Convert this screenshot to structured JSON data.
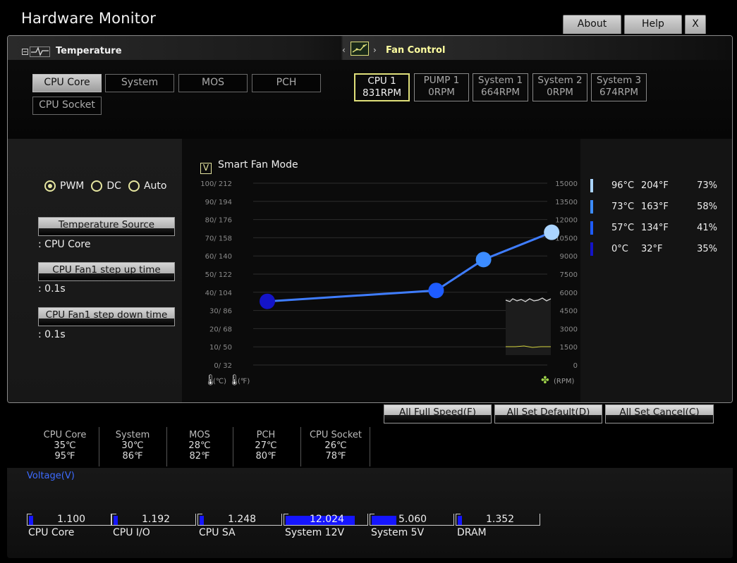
{
  "app": {
    "title": "Hardware Monitor",
    "buttons": {
      "about": "About",
      "help": "Help",
      "close": "X"
    }
  },
  "temperature": {
    "label": "Temperature",
    "tabs": [
      "CPU Core",
      "System",
      "MOS",
      "PCH",
      "CPU Socket"
    ],
    "selected": "CPU Core"
  },
  "fan_control": {
    "label": "Fan Control",
    "fans": [
      {
        "name": "CPU 1",
        "rpm": "831RPM"
      },
      {
        "name": "PUMP 1",
        "rpm": "0RPM"
      },
      {
        "name": "System 1",
        "rpm": "664RPM"
      },
      {
        "name": "System 2",
        "rpm": "0RPM"
      },
      {
        "name": "System 3",
        "rpm": "674RPM"
      }
    ],
    "selected": "CPU 1"
  },
  "mode": {
    "options": [
      "PWM",
      "DC",
      "Auto"
    ],
    "selected": "PWM"
  },
  "settings": {
    "temp_source_label": "Temperature Source",
    "temp_source_value": ": CPU Core",
    "step_up_label": "CPU Fan1 step up time",
    "step_up_value": ": 0.1s",
    "step_down_label": "CPU Fan1 step down time",
    "step_down_value": ": 0.1s"
  },
  "smart_fan": {
    "label": "Smart Fan Mode",
    "checked": true,
    "check_glyph": "V"
  },
  "chart_data": {
    "type": "line",
    "left_ticks": [
      "100/ 212",
      "90/ 194",
      "80/ 176",
      "70/ 158",
      "60/ 140",
      "50/ 122",
      "40/ 104",
      "30/  86",
      "20/  68",
      "10/  50",
      "0/  32"
    ],
    "right_ticks": [
      "15000",
      "13500",
      "12000",
      "10500",
      "9000",
      "7500",
      "6000",
      "4500",
      "3000",
      "1500",
      "0"
    ],
    "xlabel_c": "(℃)",
    "xlabel_f": "(℉)",
    "rpm_label": "(RPM)",
    "x_temp_c": [
      0,
      57,
      73,
      96
    ],
    "y_percent": [
      35,
      41,
      58,
      73
    ],
    "point_colors": [
      "#1414c8",
      "#1e5cff",
      "#3c8cff",
      "#aad4ff"
    ]
  },
  "legend": [
    {
      "c": "96°C",
      "f": "204°F",
      "p": "73%",
      "color": "#aad4ff"
    },
    {
      "c": "73°C",
      "f": "163°F",
      "p": "58%",
      "color": "#3c8cff"
    },
    {
      "c": "57°C",
      "f": "134°F",
      "p": "41%",
      "color": "#1e5cff"
    },
    {
      "c": "0°C",
      "f": "32°F",
      "p": "35%",
      "color": "#1414c8"
    }
  ],
  "actions": {
    "full_speed": "All Full Speed(F)",
    "set_default": "All Set Default(D)",
    "set_cancel": "All Set Cancel(C)"
  },
  "temps": [
    {
      "name": "CPU Core",
      "c": "35℃",
      "f": "95℉"
    },
    {
      "name": "System",
      "c": "30℃",
      "f": "86℉"
    },
    {
      "name": "MOS",
      "c": "28℃",
      "f": "82℉"
    },
    {
      "name": "PCH",
      "c": "27℃",
      "f": "80℉"
    },
    {
      "name": "CPU Socket",
      "c": "26℃",
      "f": "78℉"
    }
  ],
  "voltage": {
    "title": "Voltage(V)",
    "items": [
      {
        "name": "CPU Core",
        "value": "1.100",
        "fill": 0.06
      },
      {
        "name": "CPU I/O",
        "value": "1.192",
        "fill": 0.06
      },
      {
        "name": "CPU SA",
        "value": "1.248",
        "fill": 0.06
      },
      {
        "name": "System 12V",
        "value": "12.024",
        "fill": 0.98
      },
      {
        "name": "System 5V",
        "value": "5.060",
        "fill": 0.35
      },
      {
        "name": "DRAM",
        "value": "1.352",
        "fill": 0.06
      }
    ]
  }
}
